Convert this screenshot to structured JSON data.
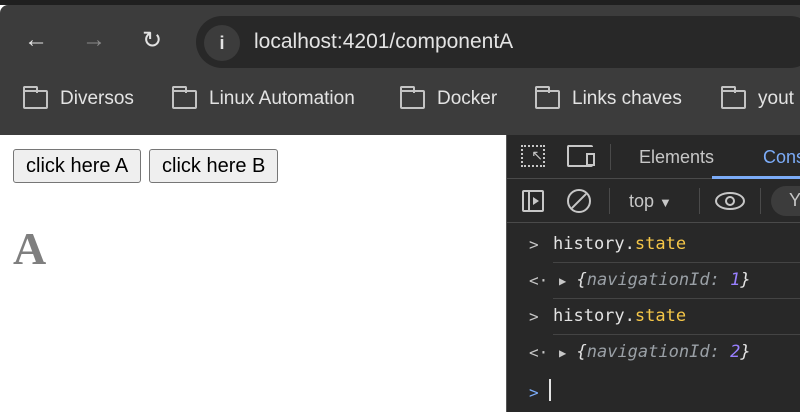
{
  "browser": {
    "url": "localhost:4201/componentA",
    "bookmarks": [
      "Diversos",
      "Linux Automation",
      "Docker",
      "Links chaves",
      "yout"
    ]
  },
  "page": {
    "button_a": "click here A",
    "button_b": "click here B",
    "heading": "A"
  },
  "devtools": {
    "tabs": [
      "Elements",
      "Cons"
    ],
    "context": "top",
    "console": [
      {
        "type": "input",
        "obj": "history",
        "prop": "state"
      },
      {
        "type": "output",
        "open": "{",
        "key": "navigationId",
        "colon": ":",
        "value": "1",
        "close": "}"
      },
      {
        "type": "input",
        "obj": "history",
        "prop": "state"
      },
      {
        "type": "output",
        "open": "{",
        "key": "navigationId",
        "colon": ":",
        "value": "2",
        "close": "}"
      }
    ]
  }
}
